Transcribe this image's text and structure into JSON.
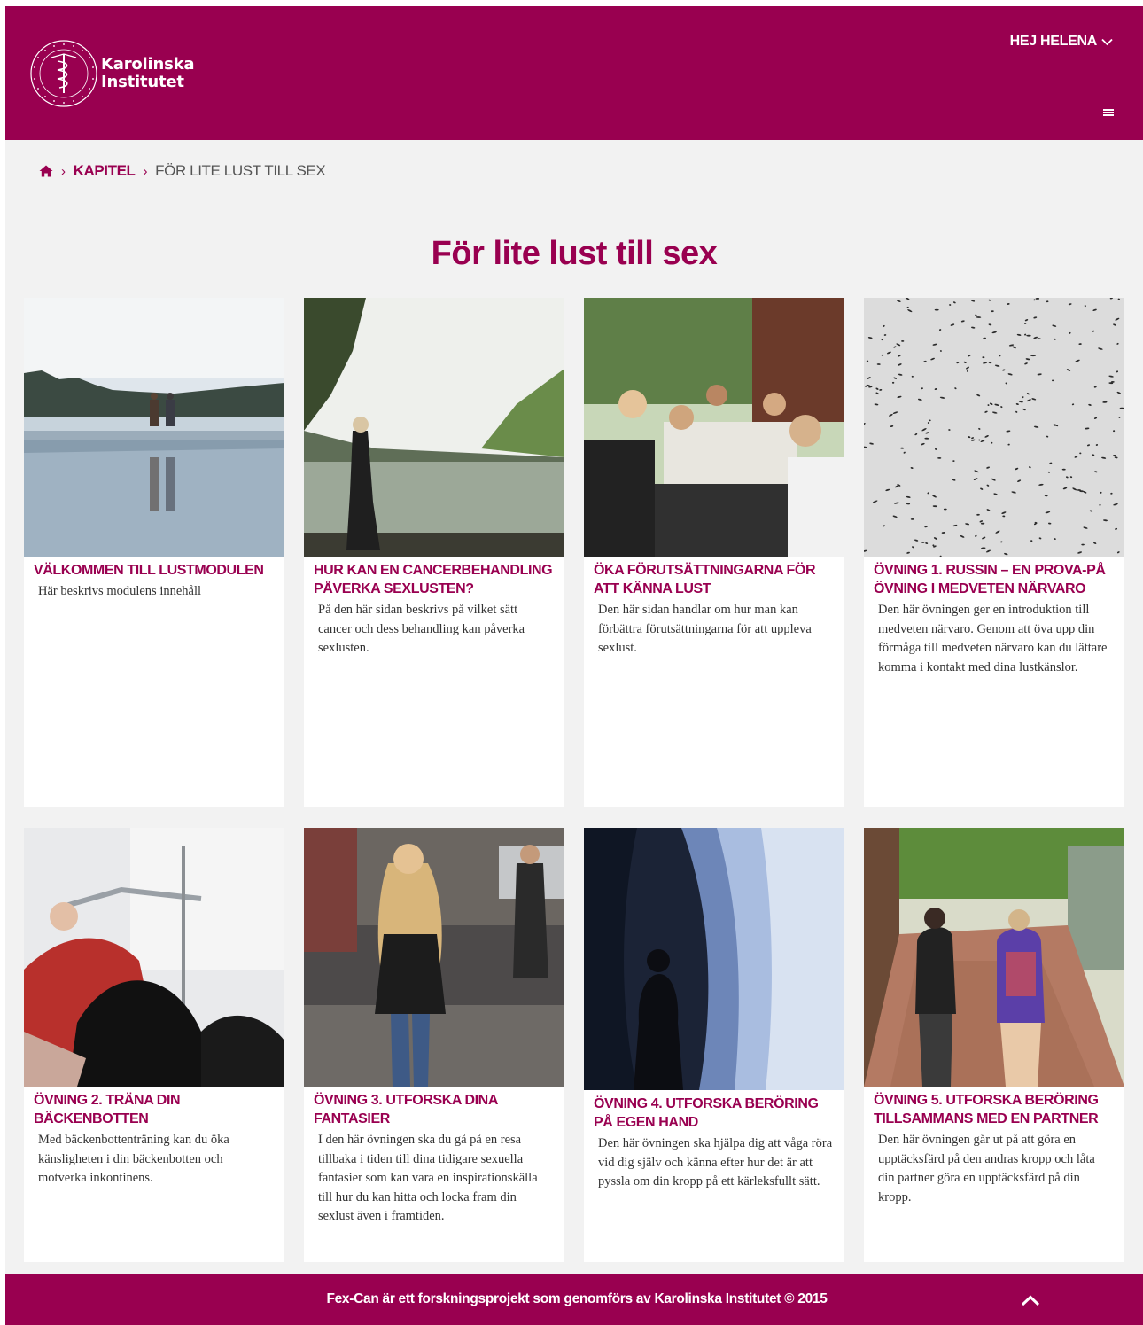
{
  "header": {
    "logo_line1": "Karolinska",
    "logo_line2": "Institutet",
    "user_greeting": "HEJ HELENA"
  },
  "breadcrumb": {
    "link": "KAPITEL",
    "current": "FÖR LITE LUST TILL SEX"
  },
  "page_title": "För lite lust till sex",
  "cards": [
    {
      "title": "Välkommen till lustmodulen",
      "description": "Här beskrivs modulens innehåll"
    },
    {
      "title": "Hur kan en cancerbehandling påverka sexlusten?",
      "description": "På den här sidan beskrivs på vilket sätt cancer och dess behandling kan påverka sexlusten."
    },
    {
      "title": "Öka förutsättningarna för att känna lust",
      "description": "Den här sidan handlar om hur man kan förbättra förutsättningarna för att uppleva sexlust."
    },
    {
      "title": "Övning 1. Russin – en prova-på övning i medveten närvaro",
      "description": "Den här övningen ger en introduktion till medveten närvaro. Genom att öva upp din förmåga till medveten närvaro kan du lättare komma i kontakt med dina lustkänslor."
    },
    {
      "title": "Övning 2. Träna din bäckenbotten",
      "description": "Med bäckenbottenträning kan du öka känsligheten i din bäckenbotten och motverka inkontinens."
    },
    {
      "title": "Övning 3. Utforska dina fantasier",
      "description": "I den här övningen ska du gå på en resa tillbaka i tiden till dina tidigare sexuella fantasier som kan vara en inspirationskälla till hur du kan hitta och locka fram din sexlust även i framtiden."
    },
    {
      "title": "Övning 4. Utforska beröring på egen hand",
      "description": "Den här övningen ska hjälpa dig att våga röra vid dig själv och känna efter hur det är att pyssla om din kropp på ett kärleksfullt sätt."
    },
    {
      "title": "Övning 5. Utforska beröring tillsammans med en partner",
      "description": "Den här övningen går ut på att göra en upptäcksfärd på den andras kropp och låta din partner göra en upptäcksfärd på din kropp."
    }
  ],
  "footer": {
    "text": "Fex-Can är ett forskningsprojekt som genomförs av Karolinska Institutet © 2015"
  },
  "colors": {
    "brand": "#990050",
    "background": "#f2f2f2"
  },
  "icons": {
    "home": "home-icon",
    "user_menu": "chevron-down-icon",
    "menu": "hamburger-icon",
    "back_to_top": "chevron-up-icon"
  }
}
